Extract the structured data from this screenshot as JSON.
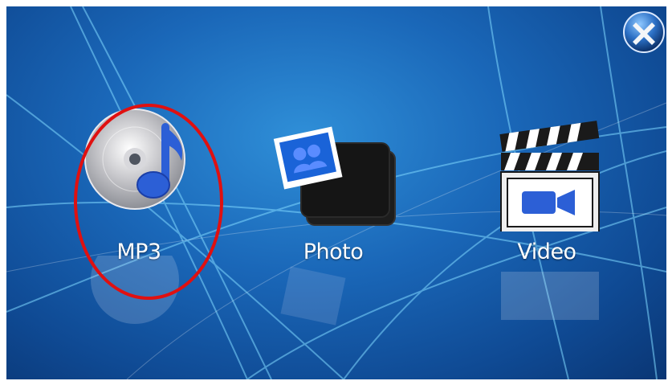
{
  "window": {
    "close_icon": "close-x-icon"
  },
  "apps": [
    {
      "id": "mp3",
      "label": "MP3",
      "icon": "music-disc-note-icon"
    },
    {
      "id": "photo",
      "label": "Photo",
      "icon": "photo-stack-icon"
    },
    {
      "id": "video",
      "label": "Video",
      "icon": "clapperboard-camera-icon"
    }
  ],
  "colors": {
    "highlight_ring": "#e01010",
    "accent_blue": "#2c5fd6"
  }
}
